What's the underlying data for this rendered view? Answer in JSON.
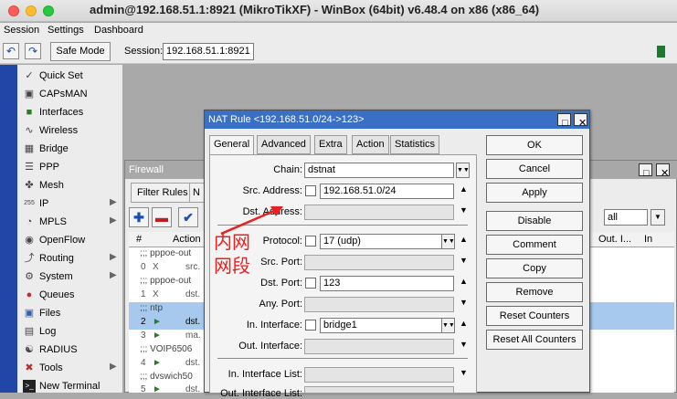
{
  "window": {
    "title": "admin@192.168.51.1:8921 (MikroTikXF) - WinBox (64bit) v6.48.4 on x86 (x86_64)"
  },
  "menu": [
    "Session",
    "Settings",
    "Dashboard"
  ],
  "toolbar": {
    "safe_mode": "Safe Mode",
    "session_label": "Session:",
    "session_value": "192.168.51.1:8921"
  },
  "sidebar": [
    {
      "label": "Quick Set",
      "icon": "quickset-icon",
      "arrow": false
    },
    {
      "label": "CAPsMAN",
      "icon": "capsman-icon",
      "arrow": false
    },
    {
      "label": "Interfaces",
      "icon": "interfaces-icon",
      "arrow": false
    },
    {
      "label": "Wireless",
      "icon": "wireless-icon",
      "arrow": false
    },
    {
      "label": "Bridge",
      "icon": "bridge-icon",
      "arrow": false
    },
    {
      "label": "PPP",
      "icon": "ppp-icon",
      "arrow": false
    },
    {
      "label": "Mesh",
      "icon": "mesh-icon",
      "arrow": false
    },
    {
      "label": "IP",
      "icon": "ip-icon",
      "arrow": true
    },
    {
      "label": "MPLS",
      "icon": "mpls-icon",
      "arrow": true
    },
    {
      "label": "OpenFlow",
      "icon": "openflow-icon",
      "arrow": false
    },
    {
      "label": "Routing",
      "icon": "routing-icon",
      "arrow": true
    },
    {
      "label": "System",
      "icon": "system-icon",
      "arrow": true
    },
    {
      "label": "Queues",
      "icon": "queues-icon",
      "arrow": false
    },
    {
      "label": "Files",
      "icon": "files-icon",
      "arrow": false
    },
    {
      "label": "Log",
      "icon": "log-icon",
      "arrow": false
    },
    {
      "label": "RADIUS",
      "icon": "radius-icon",
      "arrow": false
    },
    {
      "label": "Tools",
      "icon": "tools-icon",
      "arrow": true
    },
    {
      "label": "New Terminal",
      "icon": "terminal-icon",
      "arrow": false
    }
  ],
  "firewall": {
    "title": "Firewall",
    "tabs": [
      "Filter Rules",
      "N"
    ],
    "filter_value": "all",
    "columns": [
      "#",
      "Action",
      "Out. I...",
      "In"
    ],
    "rows": [
      {
        "comment": ";;; pppoe-out"
      },
      {
        "num": "0",
        "flag": "X",
        "action": "src."
      },
      {
        "comment": ";;; pppoe-out"
      },
      {
        "num": "1",
        "flag": "X",
        "action": "dst."
      },
      {
        "comment": ";;; ntp",
        "selected": true
      },
      {
        "num": "2",
        "flag": "",
        "action": "dst.",
        "selected": true
      },
      {
        "num": "3",
        "flag": "",
        "action": "ma."
      },
      {
        "comment": ";;; VOIP6506"
      },
      {
        "num": "4",
        "flag": "",
        "action": "dst."
      },
      {
        "comment": ";;; dvswich50"
      },
      {
        "num": "5",
        "flag": "",
        "action": "dst."
      }
    ]
  },
  "nat": {
    "title": "NAT Rule <192.168.51.0/24->123>",
    "tabs": [
      "General",
      "Advanced",
      "Extra",
      "Action",
      "Statistics"
    ],
    "fields": {
      "chain_label": "Chain:",
      "chain_value": "dstnat",
      "src_label": "Src. Address:",
      "src_value": "192.168.51.0/24",
      "dst_label": "Dst. Address:",
      "proto_label": "Protocol:",
      "proto_value": "17 (udp)",
      "srcport_label": "Src. Port:",
      "dstport_label": "Dst. Port:",
      "dstport_value": "123",
      "anyport_label": "Any. Port:",
      "inif_label": "In. Interface:",
      "inif_value": "bridge1",
      "outif_label": "Out. Interface:",
      "inlist_label": "In. Interface List:",
      "outlist_label": "Out. Interface List:"
    },
    "buttons": [
      "OK",
      "Cancel",
      "Apply",
      "Disable",
      "Comment",
      "Copy",
      "Remove",
      "Reset Counters",
      "Reset All Counters"
    ]
  },
  "annotation": {
    "line1": "内网",
    "line2": "网段",
    "color": "#e8201f"
  }
}
